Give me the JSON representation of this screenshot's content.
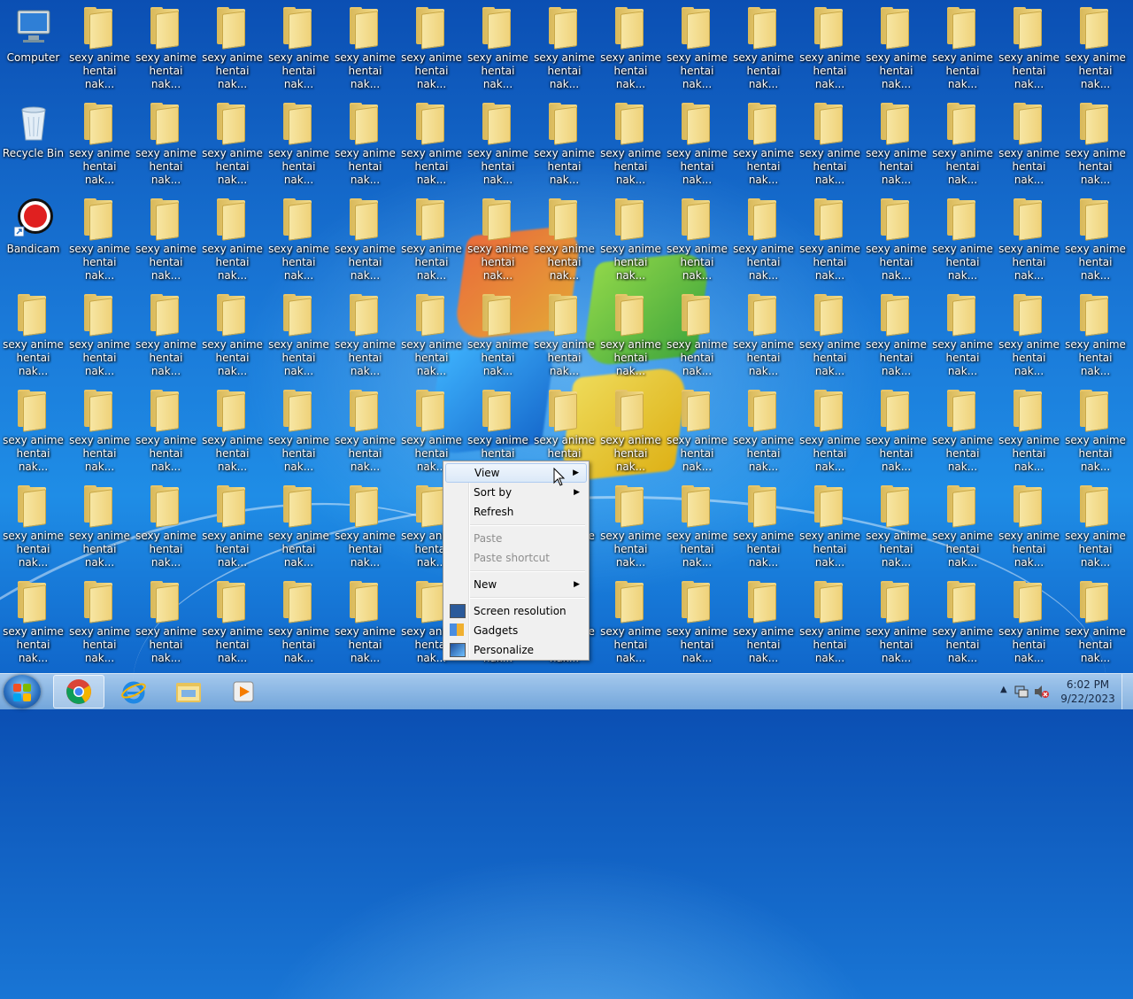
{
  "desktop": {
    "system_icons": [
      {
        "label": "Computer"
      },
      {
        "label": "Recycle Bin"
      },
      {
        "label": "Bandicam"
      }
    ],
    "folder_label_line1": "sexy anime",
    "folder_label_line2": "hentai nak...",
    "grid": {
      "columns": 17,
      "rows": 7
    }
  },
  "context_menu": {
    "items": {
      "view": "View",
      "sort_by": "Sort by",
      "refresh": "Refresh",
      "paste": "Paste",
      "paste_shortcut": "Paste shortcut",
      "new": "New",
      "screen_resolution": "Screen resolution",
      "gadgets": "Gadgets",
      "personalize": "Personalize"
    },
    "highlighted": "View"
  },
  "taskbar": {
    "pinned": [
      "start-button",
      "chrome",
      "internet-explorer",
      "windows-explorer",
      "media-player"
    ],
    "clock": {
      "time": "6:02 PM",
      "date": "9/22/2023"
    }
  },
  "colors": {
    "desktop_blue": "#1a79d8",
    "menu_bg": "#f0f0f0",
    "menu_highlight": "#dbe9f8",
    "folder_yellow": "#f4dc8a"
  }
}
